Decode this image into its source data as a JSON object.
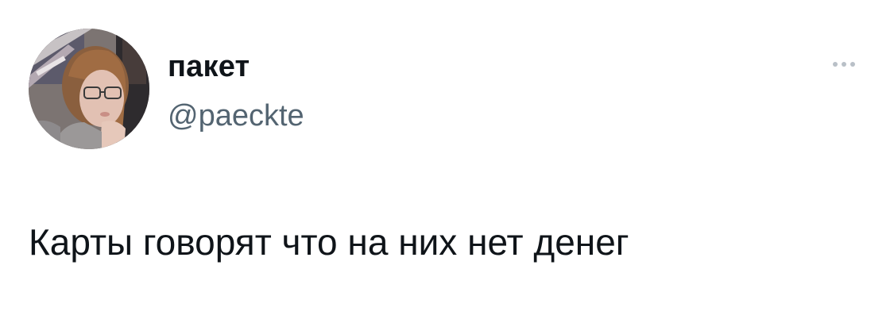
{
  "tweet": {
    "author": {
      "display_name": "пакет",
      "handle": "@paeckte",
      "avatar_icon": "profile-photo"
    },
    "more_icon": "more-horizontal-icon",
    "text": "Карты говорят что на них нет денег"
  },
  "colors": {
    "background": "#ffffff",
    "primary_text": "#0f1419",
    "secondary_text": "#536471",
    "more_icon": "#b9c0c7"
  }
}
